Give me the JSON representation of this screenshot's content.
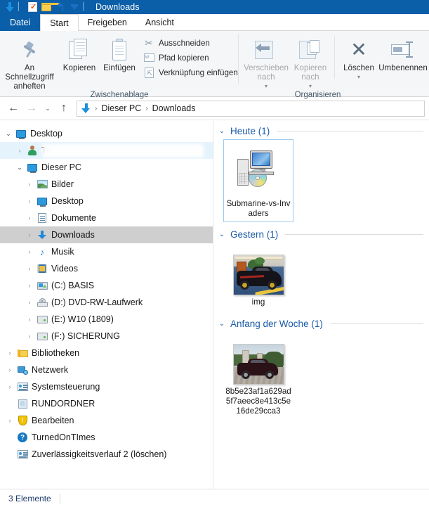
{
  "window": {
    "title": "Downloads",
    "quick_access_icons": [
      "download-arrow-icon",
      "properties-icon",
      "new-folder-icon",
      "undo-icon",
      "customize-dropdown-icon"
    ]
  },
  "ribbon": {
    "tabs": [
      {
        "label": "Datei",
        "kind": "file"
      },
      {
        "label": "Start",
        "kind": "active"
      },
      {
        "label": "Freigeben",
        "kind": "normal"
      },
      {
        "label": "Ansicht",
        "kind": "normal"
      }
    ],
    "groups": [
      {
        "title": "Zwischenablage",
        "big_buttons": [
          {
            "label": "An Schnellzugriff anheften",
            "icon": "pin-icon"
          },
          {
            "label": "Kopieren",
            "icon": "copy-icon"
          },
          {
            "label": "Einfügen",
            "icon": "paste-icon"
          }
        ],
        "small_buttons": [
          {
            "label": "Ausschneiden",
            "icon": "scissors-icon"
          },
          {
            "label": "Pfad kopieren",
            "icon": "copy-path-icon"
          },
          {
            "label": "Verknüpfung einfügen",
            "icon": "paste-shortcut-icon"
          }
        ]
      },
      {
        "title": "Organisieren",
        "big_buttons": [
          {
            "label": "Verschieben nach",
            "icon": "move-to-icon",
            "disabled": true,
            "dropdown": true
          },
          {
            "label": "Kopieren nach",
            "icon": "copy-to-icon",
            "disabled": true,
            "dropdown": true
          },
          {
            "label": "Löschen",
            "icon": "delete-x-icon",
            "dropdown": true
          },
          {
            "label": "Umbenennen",
            "icon": "rename-icon"
          }
        ]
      }
    ]
  },
  "addressbar": {
    "back_icon": "back-arrow-icon",
    "forward_icon": "forward-arrow-icon",
    "recent_icon": "recent-locations-chevron-icon",
    "up_icon": "up-arrow-icon",
    "location_icon": "download-arrow-icon",
    "breadcrumbs": [
      "Dieser PC",
      "Downloads"
    ],
    "separator": "›"
  },
  "navigation_pane": {
    "items": [
      {
        "label": "Desktop",
        "icon": "monitor-icon",
        "indent": 0,
        "chevron": "open",
        "state": "normal"
      },
      {
        "label": "Th",
        "icon": "user-icon",
        "indent": 1,
        "chevron": "closed",
        "state": "hover",
        "redacted": true
      },
      {
        "label": "Dieser PC",
        "icon": "monitor-icon",
        "indent": 1,
        "chevron": "open",
        "state": "normal"
      },
      {
        "label": "Bilder",
        "icon": "pictures-icon",
        "indent": 2,
        "chevron": "closed",
        "state": "normal"
      },
      {
        "label": "Desktop",
        "icon": "monitor-icon",
        "indent": 2,
        "chevron": "closed",
        "state": "normal"
      },
      {
        "label": "Dokumente",
        "icon": "document-icon",
        "indent": 2,
        "chevron": "closed",
        "state": "normal"
      },
      {
        "label": "Downloads",
        "icon": "download-arrow-icon",
        "indent": 2,
        "chevron": "closed",
        "state": "selected"
      },
      {
        "label": "Musik",
        "icon": "music-note-icon",
        "indent": 2,
        "chevron": "closed",
        "state": "normal"
      },
      {
        "label": "Videos",
        "icon": "video-icon",
        "indent": 2,
        "chevron": "closed",
        "state": "normal"
      },
      {
        "label": "(C:) BASIS",
        "icon": "system-drive-icon",
        "indent": 2,
        "chevron": "closed",
        "state": "normal"
      },
      {
        "label": "(D:) DVD-RW-Laufwerk",
        "icon": "dvd-drive-icon",
        "indent": 2,
        "chevron": "closed",
        "state": "normal"
      },
      {
        "label": "(E:) W10 (1809)",
        "icon": "drive-icon",
        "indent": 2,
        "chevron": "closed",
        "state": "normal"
      },
      {
        "label": "(F:) SICHERUNG",
        "icon": "drive-icon",
        "indent": 2,
        "chevron": "closed",
        "state": "normal"
      },
      {
        "label": "Bibliotheken",
        "icon": "libraries-icon",
        "indent": 1,
        "chevron": "closed",
        "state": "normal"
      },
      {
        "label": "Netzwerk",
        "icon": "network-icon",
        "indent": 1,
        "chevron": "closed",
        "state": "normal"
      },
      {
        "label": "Systemsteuerung",
        "icon": "control-panel-icon",
        "indent": 1,
        "chevron": "closed",
        "state": "normal"
      },
      {
        "label": "RUNDORDNER",
        "icon": "recycle-bin-icon",
        "indent": 1,
        "chevron": "none",
        "state": "normal"
      },
      {
        "label": "Bearbeiten",
        "icon": "shield-icon",
        "indent": 1,
        "chevron": "closed",
        "state": "normal"
      },
      {
        "label": "TurnedOnTImes",
        "icon": "help-icon",
        "indent": 1,
        "chevron": "none",
        "state": "normal"
      },
      {
        "label": "Zuverlässigkeitsverlauf 2 (löschen)",
        "icon": "control-panel-icon",
        "indent": 1,
        "chevron": "none",
        "state": "normal"
      }
    ]
  },
  "content": {
    "groups": [
      {
        "header": "Heute (1)",
        "chevron": "open",
        "items": [
          {
            "name": "Submarine-vs-Invaders",
            "thumb": "program-setup-icon",
            "selected": true
          }
        ]
      },
      {
        "header": "Gestern (1)",
        "chevron": "open",
        "items": [
          {
            "name": "img",
            "thumb": "photo-black-car-garage",
            "selected": false
          }
        ]
      },
      {
        "header": "Anfang der Woche (1)",
        "chevron": "open",
        "items": [
          {
            "name": "8b5e23af1a629ad5f7aeec8e413c5e16de29cca3",
            "thumb": "photo-dark-car-driveway",
            "selected": false
          }
        ]
      }
    ]
  },
  "statusbar": {
    "item_count": "3 Elemente"
  },
  "colors": {
    "titlebar": "#0b5ea8",
    "accent": "#1b5ba8",
    "selection": "#cfcfcf",
    "hover": "#e5f3fd",
    "ribbon_bg": "#f4f6f8"
  }
}
